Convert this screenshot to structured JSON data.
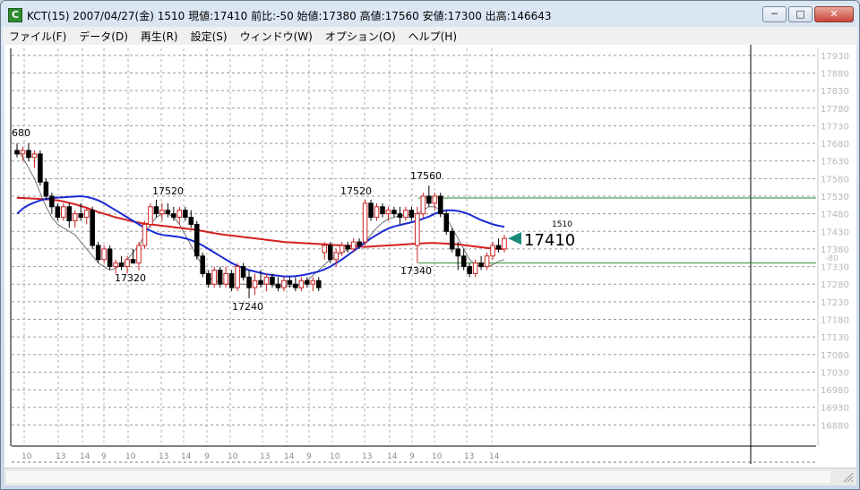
{
  "window": {
    "icon_letter": "C",
    "title": "KCT(15) 2007/04/27(金) 1510 現値:17410 前比:-50 始値:17380 高値:17560 安値:17300 出高:146643",
    "minimize": "─",
    "maximize": "□",
    "close": "✕"
  },
  "menu": [
    "ファイル(F)",
    "データ(D)",
    "再生(R)",
    "設定(S)",
    "ウィンドウ(W)",
    "オプション(O)",
    "ヘルプ(H)"
  ],
  "chart": {
    "y_axis_labels": [
      "17930",
      "17880",
      "17830",
      "17780",
      "17730",
      "17680",
      "17630",
      "17580",
      "17530",
      "17480",
      "17430",
      "17380",
      "17330",
      "17280",
      "17230",
      "17180",
      "17130",
      "17080",
      "17030",
      "16980",
      "16930",
      "16880"
    ],
    "x_axis_labels": [
      "10",
      "13",
      "14",
      "9",
      "10",
      "13",
      "14",
      "9",
      "10",
      "13",
      "14",
      "9",
      "10",
      "13",
      "14",
      "9",
      "10",
      "13",
      "14"
    ],
    "annotations": {
      "left_high": "680",
      "peak1": "17520",
      "trough1": "17320",
      "trough2": "17240",
      "peak2": "17520",
      "peak3": "17560",
      "trough3": "17340",
      "time_label": "1510",
      "current_price": "17410",
      "offset_label": "-80"
    },
    "colors": {
      "up": "#cc2222",
      "down": "#000000",
      "ma_red": "#d42020",
      "ma_blue": "#1a2ad4",
      "ma_thin": "#555555",
      "hline": "#2e8b2e",
      "marker": "#1a8a7a"
    }
  },
  "chart_data": {
    "type": "candlestick",
    "ylim": [
      16830,
      17950
    ],
    "current": 17410,
    "support_line": 17340,
    "resistance_line": 17525,
    "candles": [
      {
        "o": 17660,
        "h": 17680,
        "l": 17640,
        "c": 17650
      },
      {
        "o": 17650,
        "h": 17670,
        "l": 17630,
        "c": 17660
      },
      {
        "o": 17660,
        "h": 17680,
        "l": 17630,
        "c": 17640
      },
      {
        "o": 17640,
        "h": 17660,
        "l": 17610,
        "c": 17650
      },
      {
        "o": 17650,
        "h": 17660,
        "l": 17560,
        "c": 17570
      },
      {
        "o": 17570,
        "h": 17580,
        "l": 17520,
        "c": 17530
      },
      {
        "o": 17530,
        "h": 17540,
        "l": 17480,
        "c": 17500
      },
      {
        "o": 17500,
        "h": 17510,
        "l": 17460,
        "c": 17470
      },
      {
        "o": 17470,
        "h": 17510,
        "l": 17460,
        "c": 17500
      },
      {
        "o": 17500,
        "h": 17510,
        "l": 17440,
        "c": 17460
      },
      {
        "o": 17460,
        "h": 17490,
        "l": 17440,
        "c": 17480
      },
      {
        "o": 17480,
        "h": 17510,
        "l": 17460,
        "c": 17470
      },
      {
        "o": 17470,
        "h": 17500,
        "l": 17450,
        "c": 17490
      },
      {
        "o": 17490,
        "h": 17500,
        "l": 17380,
        "c": 17390
      },
      {
        "o": 17390,
        "h": 17400,
        "l": 17340,
        "c": 17350
      },
      {
        "o": 17350,
        "h": 17390,
        "l": 17340,
        "c": 17380
      },
      {
        "o": 17380,
        "h": 17390,
        "l": 17320,
        "c": 17330
      },
      {
        "o": 17330,
        "h": 17350,
        "l": 17310,
        "c": 17340
      },
      {
        "o": 17340,
        "h": 17360,
        "l": 17320,
        "c": 17330
      },
      {
        "o": 17330,
        "h": 17360,
        "l": 17310,
        "c": 17350
      },
      {
        "o": 17350,
        "h": 17380,
        "l": 17340,
        "c": 17340
      },
      {
        "o": 17340,
        "h": 17400,
        "l": 17320,
        "c": 17390
      },
      {
        "o": 17390,
        "h": 17460,
        "l": 17380,
        "c": 17450
      },
      {
        "o": 17450,
        "h": 17510,
        "l": 17440,
        "c": 17500
      },
      {
        "o": 17500,
        "h": 17520,
        "l": 17470,
        "c": 17480
      },
      {
        "o": 17480,
        "h": 17510,
        "l": 17460,
        "c": 17490
      },
      {
        "o": 17490,
        "h": 17510,
        "l": 17470,
        "c": 17480
      },
      {
        "o": 17480,
        "h": 17500,
        "l": 17460,
        "c": 17470
      },
      {
        "o": 17470,
        "h": 17500,
        "l": 17450,
        "c": 17490
      },
      {
        "o": 17490,
        "h": 17500,
        "l": 17460,
        "c": 17470
      },
      {
        "o": 17470,
        "h": 17490,
        "l": 17440,
        "c": 17450
      },
      {
        "o": 17450,
        "h": 17460,
        "l": 17350,
        "c": 17360
      },
      {
        "o": 17360,
        "h": 17370,
        "l": 17300,
        "c": 17310
      },
      {
        "o": 17310,
        "h": 17320,
        "l": 17270,
        "c": 17280
      },
      {
        "o": 17280,
        "h": 17330,
        "l": 17270,
        "c": 17320
      },
      {
        "o": 17320,
        "h": 17330,
        "l": 17270,
        "c": 17280
      },
      {
        "o": 17280,
        "h": 17330,
        "l": 17270,
        "c": 17310
      },
      {
        "o": 17310,
        "h": 17320,
        "l": 17260,
        "c": 17270
      },
      {
        "o": 17270,
        "h": 17340,
        "l": 17260,
        "c": 17330
      },
      {
        "o": 17330,
        "h": 17340,
        "l": 17290,
        "c": 17300
      },
      {
        "o": 17300,
        "h": 17320,
        "l": 17240,
        "c": 17270
      },
      {
        "o": 17270,
        "h": 17310,
        "l": 17250,
        "c": 17290
      },
      {
        "o": 17290,
        "h": 17320,
        "l": 17270,
        "c": 17280
      },
      {
        "o": 17280,
        "h": 17310,
        "l": 17260,
        "c": 17300
      },
      {
        "o": 17300,
        "h": 17310,
        "l": 17270,
        "c": 17280
      },
      {
        "o": 17280,
        "h": 17300,
        "l": 17260,
        "c": 17270
      },
      {
        "o": 17270,
        "h": 17300,
        "l": 17260,
        "c": 17290
      },
      {
        "o": 17290,
        "h": 17300,
        "l": 17270,
        "c": 17280
      },
      {
        "o": 17280,
        "h": 17300,
        "l": 17260,
        "c": 17270
      },
      {
        "o": 17270,
        "h": 17300,
        "l": 17260,
        "c": 17290
      },
      {
        "o": 17290,
        "h": 17300,
        "l": 17270,
        "c": 17280
      },
      {
        "o": 17280,
        "h": 17300,
        "l": 17260,
        "c": 17290
      },
      {
        "o": 17290,
        "h": 17300,
        "l": 17260,
        "c": 17270
      },
      {
        "o": 17370,
        "h": 17400,
        "l": 17350,
        "c": 17390
      },
      {
        "o": 17390,
        "h": 17400,
        "l": 17340,
        "c": 17350
      },
      {
        "o": 17350,
        "h": 17380,
        "l": 17330,
        "c": 17370
      },
      {
        "o": 17370,
        "h": 17400,
        "l": 17360,
        "c": 17390
      },
      {
        "o": 17390,
        "h": 17400,
        "l": 17370,
        "c": 17380
      },
      {
        "o": 17380,
        "h": 17410,
        "l": 17370,
        "c": 17400
      },
      {
        "o": 17400,
        "h": 17410,
        "l": 17380,
        "c": 17390
      },
      {
        "o": 17400,
        "h": 17520,
        "l": 17390,
        "c": 17510
      },
      {
        "o": 17510,
        "h": 17520,
        "l": 17460,
        "c": 17470
      },
      {
        "o": 17470,
        "h": 17510,
        "l": 17460,
        "c": 17500
      },
      {
        "o": 17500,
        "h": 17510,
        "l": 17470,
        "c": 17480
      },
      {
        "o": 17480,
        "h": 17500,
        "l": 17460,
        "c": 17490
      },
      {
        "o": 17490,
        "h": 17500,
        "l": 17470,
        "c": 17480
      },
      {
        "o": 17480,
        "h": 17500,
        "l": 17450,
        "c": 17470
      },
      {
        "o": 17470,
        "h": 17500,
        "l": 17460,
        "c": 17490
      },
      {
        "o": 17490,
        "h": 17500,
        "l": 17460,
        "c": 17470
      },
      {
        "o": 17390,
        "h": 17500,
        "l": 17340,
        "c": 17480
      },
      {
        "o": 17480,
        "h": 17540,
        "l": 17470,
        "c": 17530
      },
      {
        "o": 17530,
        "h": 17560,
        "l": 17500,
        "c": 17510
      },
      {
        "o": 17510,
        "h": 17540,
        "l": 17490,
        "c": 17530
      },
      {
        "o": 17530,
        "h": 17540,
        "l": 17470,
        "c": 17480
      },
      {
        "o": 17480,
        "h": 17490,
        "l": 17420,
        "c": 17430
      },
      {
        "o": 17430,
        "h": 17440,
        "l": 17370,
        "c": 17380
      },
      {
        "o": 17380,
        "h": 17400,
        "l": 17320,
        "c": 17360
      },
      {
        "o": 17360,
        "h": 17380,
        "l": 17320,
        "c": 17330
      },
      {
        "o": 17330,
        "h": 17340,
        "l": 17300,
        "c": 17310
      },
      {
        "o": 17310,
        "h": 17350,
        "l": 17300,
        "c": 17340
      },
      {
        "o": 17340,
        "h": 17360,
        "l": 17320,
        "c": 17330
      },
      {
        "o": 17330,
        "h": 17370,
        "l": 17320,
        "c": 17360
      },
      {
        "o": 17360,
        "h": 17400,
        "l": 17350,
        "c": 17390
      },
      {
        "o": 17390,
        "h": 17410,
        "l": 17370,
        "c": 17380
      },
      {
        "o": 17380,
        "h": 17420,
        "l": 17370,
        "c": 17410
      }
    ],
    "ma_red": [
      17525,
      17525,
      17524,
      17523,
      17522,
      17521,
      17520,
      17518,
      17515,
      17511,
      17507,
      17502,
      17497,
      17491,
      17485,
      17480,
      17475,
      17470,
      17466,
      17462,
      17458,
      17455,
      17452,
      17450,
      17448,
      17446,
      17444,
      17442,
      17440,
      17438,
      17436,
      17434,
      17431,
      17428,
      17425,
      17422,
      17420,
      17418,
      17416,
      17414,
      17412,
      17410,
      17408,
      17406,
      17404,
      17402,
      17400,
      17399,
      17398,
      17397,
      17396,
      17395,
      17394,
      17393,
      17392,
      17391,
      17390,
      17389,
      17388,
      17387,
      17386,
      17387,
      17388,
      17389,
      17390,
      17391,
      17392,
      17393,
      17394,
      17395,
      17396,
      17397,
      17397,
      17396,
      17395,
      17394,
      17393,
      17391,
      17389,
      17387,
      17385,
      17383,
      17381,
      17380,
      17380
    ],
    "ma_blue": [
      17480,
      17495,
      17505,
      17512,
      17518,
      17522,
      17525,
      17526,
      17527,
      17528,
      17529,
      17530,
      17528,
      17524,
      17518,
      17510,
      17500,
      17490,
      17480,
      17470,
      17460,
      17450,
      17440,
      17432,
      17425,
      17420,
      17418,
      17416,
      17414,
      17410,
      17405,
      17398,
      17390,
      17380,
      17370,
      17360,
      17350,
      17340,
      17332,
      17326,
      17320,
      17316,
      17312,
      17308,
      17306,
      17304,
      17302,
      17302,
      17303,
      17305,
      17308,
      17312,
      17316,
      17322,
      17330,
      17340,
      17350,
      17362,
      17374,
      17386,
      17398,
      17410,
      17420,
      17430,
      17438,
      17444,
      17448,
      17452,
      17456,
      17460,
      17466,
      17472,
      17480,
      17486,
      17490,
      17490,
      17488,
      17484,
      17478,
      17470,
      17462,
      17456,
      17450,
      17446,
      17443
    ],
    "ma_thin": [
      17660,
      17640,
      17610,
      17580,
      17540,
      17500,
      17470,
      17450,
      17440,
      17430,
      17420,
      17400,
      17380,
      17360,
      17340,
      17330,
      17320,
      17325,
      17335,
      17350,
      17370,
      17390,
      17420,
      17450,
      17470,
      17480,
      17480,
      17470,
      17450,
      17420,
      17390,
      17360,
      17330,
      17300,
      17290,
      17285,
      17280,
      17280,
      17280,
      17280,
      17280,
      17280,
      17280,
      17280,
      17278,
      17276,
      17275,
      17275,
      17276,
      17280,
      17290,
      17305,
      17320,
      17335,
      17350,
      17360,
      17370,
      17378,
      17385,
      17392,
      17400,
      17420,
      17440,
      17455,
      17465,
      17470,
      17475,
      17475,
      17480,
      17480,
      17490,
      17500,
      17500,
      17490,
      17470,
      17440,
      17410,
      17380,
      17350,
      17335,
      17330,
      17330,
      17335,
      17345,
      17350
    ]
  }
}
